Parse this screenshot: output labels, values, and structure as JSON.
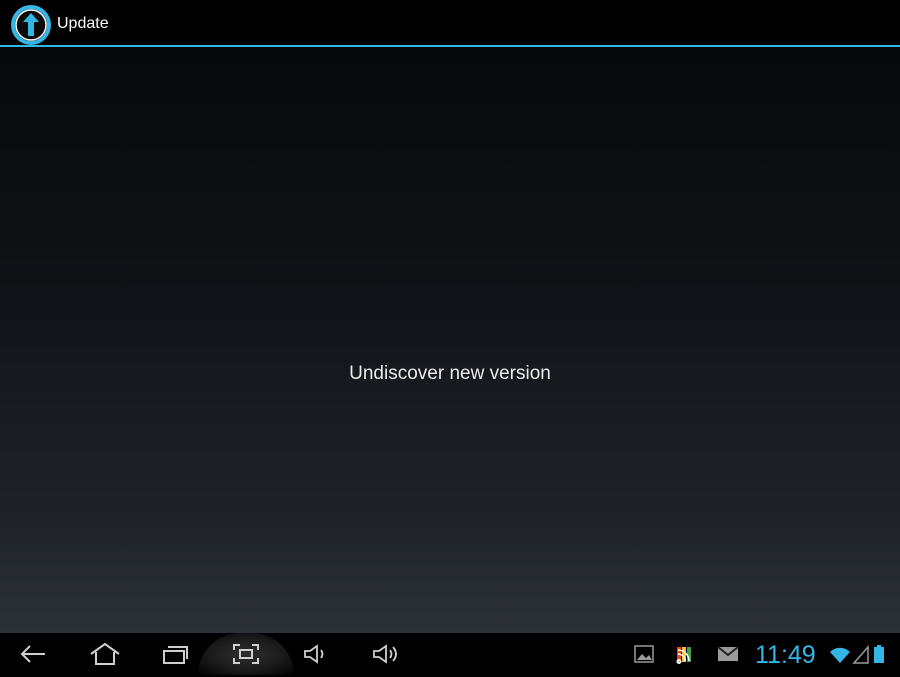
{
  "action_bar": {
    "title": "Update",
    "icon": "update-arrow-icon",
    "accent_color": "#33b5e5"
  },
  "main": {
    "message": "Undiscover new version"
  },
  "nav_bar": {
    "buttons": [
      {
        "name": "back",
        "icon": "back-icon"
      },
      {
        "name": "home",
        "icon": "home-icon"
      },
      {
        "name": "recent-apps",
        "icon": "recent-apps-icon"
      },
      {
        "name": "screenshot",
        "icon": "screenshot-icon"
      },
      {
        "name": "volume-down",
        "icon": "volume-down-icon"
      },
      {
        "name": "volume-up",
        "icon": "volume-up-icon"
      }
    ]
  },
  "status_bar": {
    "time": "11:49",
    "notifications": [
      "gallery-icon",
      "rss-icon",
      "gmail-icon"
    ],
    "indicators": [
      "wifi-icon",
      "signal-icon",
      "battery-icon"
    ],
    "clock_color": "#33b5e5"
  }
}
